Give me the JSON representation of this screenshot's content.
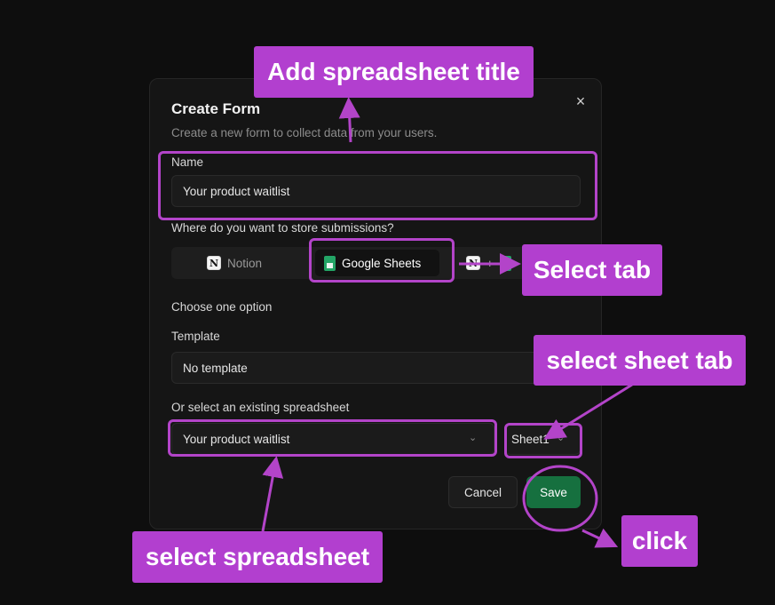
{
  "dialog": {
    "title": "Create Form",
    "subtitle": "Create a new form to collect data from your users.",
    "close_symbol": "×"
  },
  "name_field": {
    "label": "Name",
    "value": "Your product waitlist"
  },
  "storage": {
    "question": "Where do you want to store submissions?",
    "tabs": [
      {
        "label": "Notion",
        "icon": "notion-icon"
      },
      {
        "label": "Google Sheets",
        "icon": "google-sheets-icon",
        "selected": true
      },
      {
        "label": "",
        "icon": "notion-plus-sheets-icon"
      }
    ],
    "plus_symbol": "+"
  },
  "options": {
    "heading": "Choose one option",
    "template_label": "Template",
    "template_value": "No template",
    "existing_label": "Or select an existing spreadsheet",
    "spreadsheet_value": "Your product waitlist",
    "sheet_value": "Sheet1"
  },
  "actions": {
    "cancel": "Cancel",
    "save": "Save"
  },
  "annotations": {
    "title_note": "Add spreadsheet title",
    "tab_note": "Select tab",
    "sheet_tab_note": "select sheet tab",
    "spreadsheet_note": "select spreadsheet",
    "click_note": "click",
    "color": "#b23fcf"
  }
}
